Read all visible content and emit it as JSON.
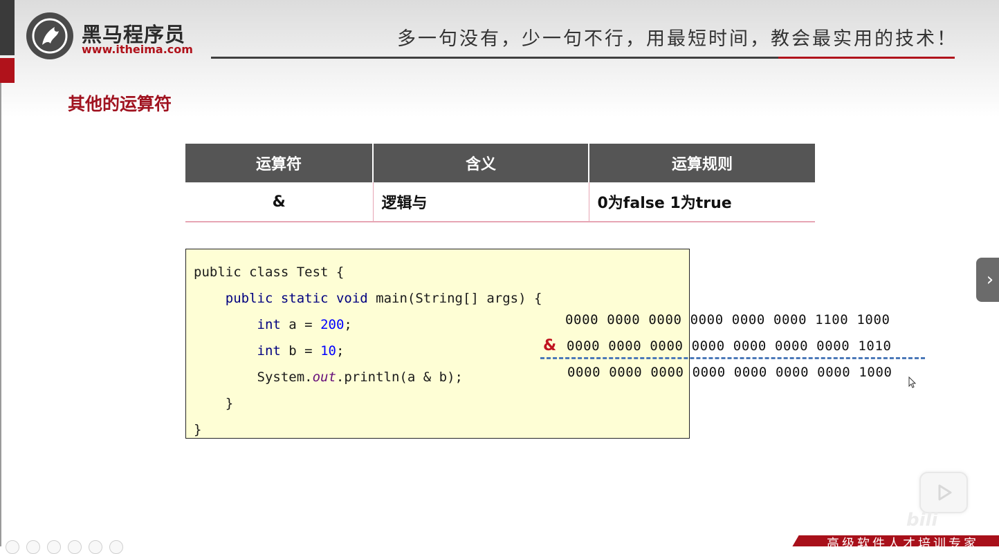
{
  "header": {
    "logo_name": "黑马程序员",
    "logo_url": "www.itheima.com",
    "slogan": "多一句没有，少一句不行，用最短时间，教会最实用的技术！"
  },
  "page_title": "其他的运算符",
  "table": {
    "headers": [
      "运算符",
      "含义",
      "运算规则"
    ],
    "rows": [
      [
        "&",
        "逻辑与",
        "0为false 1为true"
      ]
    ]
  },
  "code": {
    "line1": "public class Test {",
    "line2_kw1": "public",
    "line2_kw2": "static",
    "line2_kw3": "void",
    "line2_rest": "main(String[] args) {",
    "line3_kw": "int",
    "line3_mid": "a = ",
    "line3_num": "200",
    "line3_end": ";",
    "line4_kw": "int",
    "line4_mid": "b = ",
    "line4_num": "10",
    "line4_end": ";",
    "line5_pre": "System.",
    "line5_field": "out",
    "line5_post": ".println(a & b);",
    "line6": "}",
    "line7": "}"
  },
  "binary": {
    "a": "0000 0000 0000 0000 0000 0000 1100 1000",
    "operator": "&",
    "b": "0000 0000 0000 0000 0000 0000 0000 1010",
    "result": "0000 0000 0000 0000 0000 0000 0000 1000"
  },
  "footer": {
    "banner_text": "高级软件人才培训专家"
  },
  "colors": {
    "brand_red": "#b0121b",
    "title_red": "#a01320",
    "table_header_bg": "#555555",
    "code_bg": "#fefed5",
    "dash_blue": "#4a78b8"
  }
}
